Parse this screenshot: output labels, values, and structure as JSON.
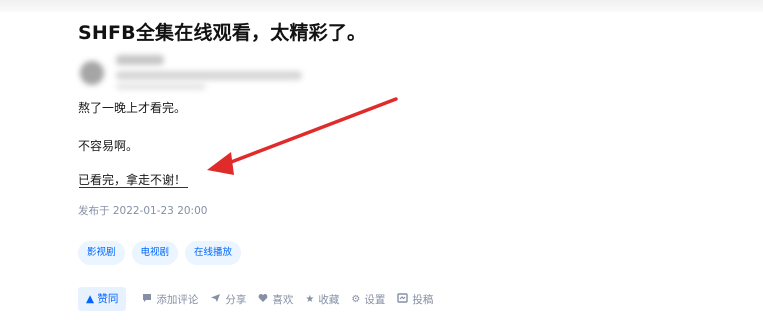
{
  "question": {
    "title": "SHFB全集在线观看，太精彩了。"
  },
  "answer": {
    "paragraphs": [
      "熬了一晚上才看完。",
      "不容易啊。",
      "已看完，拿走不谢！"
    ],
    "published": "发布于 2022-01-23 20:00"
  },
  "tags": [
    "影视剧",
    "电视剧",
    "在线播放"
  ],
  "actions": {
    "vote": "▲ 赞同",
    "comment": "添加评论",
    "share": "分享",
    "like": "喜欢",
    "favorite": "收藏",
    "settings": "设置",
    "report": "投稿"
  },
  "icons": {
    "vote": "arrow-up-icon",
    "comment": "comment-bubble-icon",
    "share": "paper-plane-icon",
    "like": "heart-icon",
    "favorite": "star-icon",
    "settings": "gear-icon",
    "report": "submit-icon",
    "annotation": "red-arrow-annotation"
  },
  "colors": {
    "accent": "#0066ff",
    "tag_bg": "#ebf5ff",
    "muted": "#8590a6",
    "annotation": "#e02b2b"
  }
}
